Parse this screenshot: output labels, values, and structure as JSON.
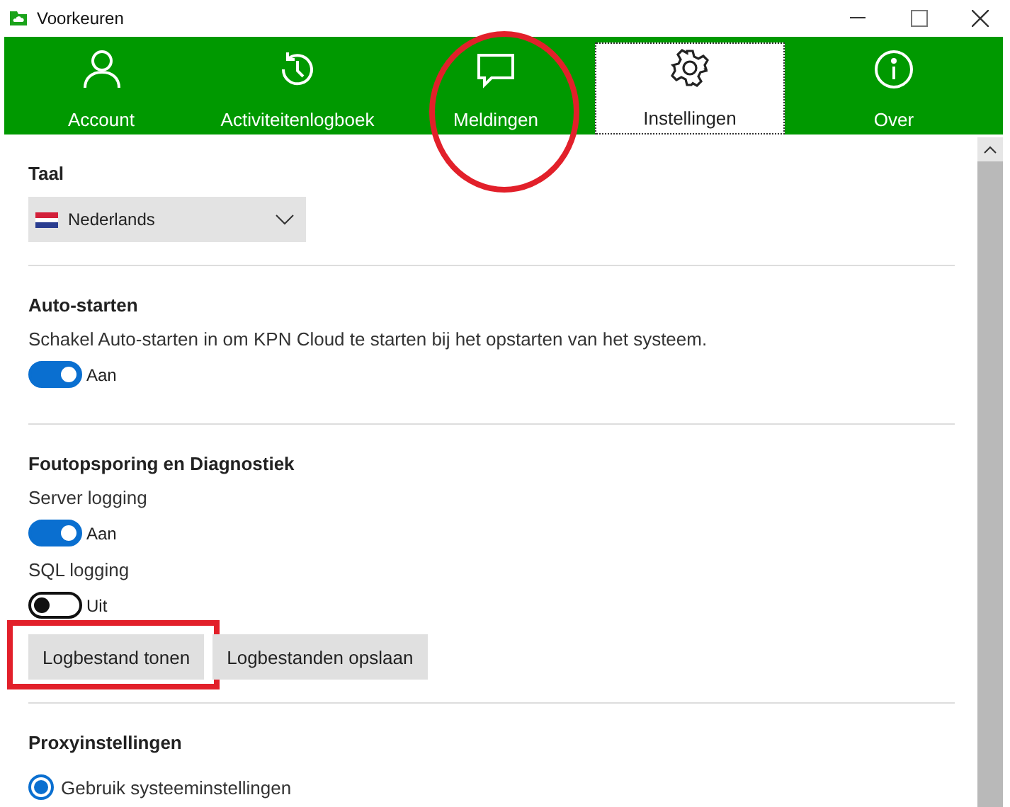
{
  "window": {
    "title": "Voorkeuren"
  },
  "tabs": [
    {
      "label": "Account",
      "selected": false,
      "circled": false
    },
    {
      "label": "Activiteitenlogboek",
      "selected": false,
      "circled": false
    },
    {
      "label": "Meldingen",
      "selected": false,
      "circled": true
    },
    {
      "label": "Instellingen",
      "selected": true,
      "circled": false
    },
    {
      "label": "Over",
      "selected": false,
      "circled": false
    }
  ],
  "language": {
    "heading": "Taal",
    "dropdown": {
      "value": "Nederlands"
    }
  },
  "autostart": {
    "heading": "Auto-starten",
    "description": "Schakel Auto-starten in om KPN Cloud te starten bij het opstarten van het systeem.",
    "toggle": {
      "on": true,
      "label": "Aan"
    }
  },
  "diagnostics": {
    "heading": "Foutopsporing en Diagnostiek",
    "settings": [
      {
        "label": "Server logging",
        "on": true,
        "state_label": "Aan"
      },
      {
        "label": "SQL logging",
        "on": false,
        "state_label": "Uit"
      }
    ],
    "buttons": [
      {
        "label": "Logbestand tonen",
        "highlighted": true
      },
      {
        "label": "Logbestanden opslaan",
        "highlighted": false
      }
    ]
  },
  "proxy": {
    "heading": "Proxyinstellingen",
    "options": [
      {
        "label": "Gebruik systeeminstellingen",
        "selected": true
      }
    ]
  }
}
